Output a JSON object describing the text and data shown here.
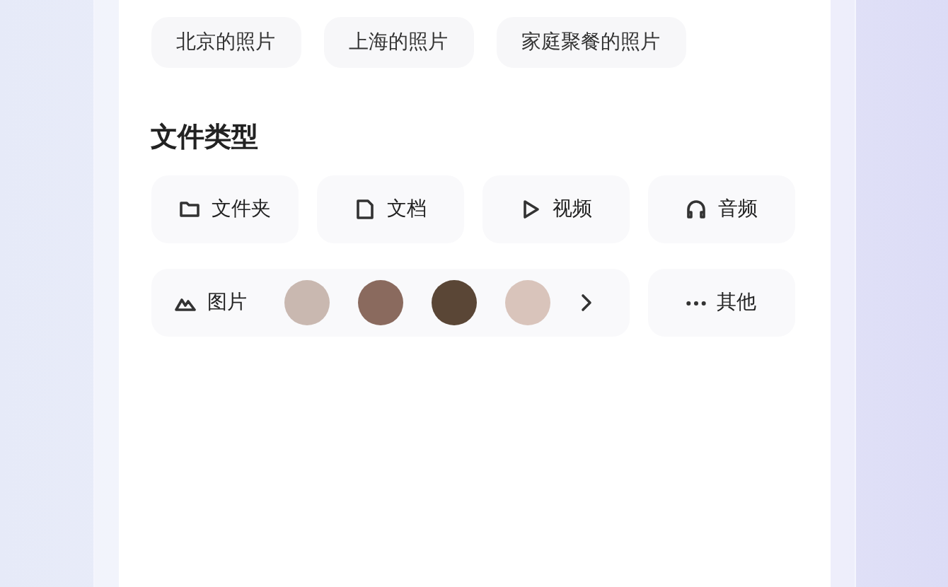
{
  "suggestions": [
    "北京的照片",
    "上海的照片",
    "家庭聚餐的照片"
  ],
  "section": {
    "title": "文件类型",
    "items": [
      {
        "kind": "folder",
        "label": "文件夹"
      },
      {
        "kind": "document",
        "label": "文档"
      },
      {
        "kind": "video",
        "label": "视频"
      },
      {
        "kind": "audio",
        "label": "音频"
      },
      {
        "kind": "image",
        "label": "图片"
      },
      {
        "kind": "more",
        "label": "其他"
      }
    ]
  }
}
